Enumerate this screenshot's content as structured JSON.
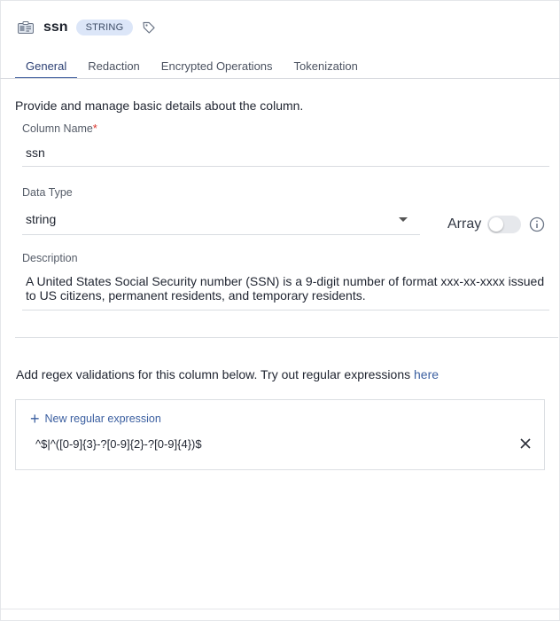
{
  "header": {
    "title": "ssn",
    "type_badge": "STRING",
    "icon": "column-icon"
  },
  "tabs": [
    {
      "label": "General",
      "active": true
    },
    {
      "label": "Redaction",
      "active": false
    },
    {
      "label": "Encrypted Operations",
      "active": false
    },
    {
      "label": "Tokenization",
      "active": false
    }
  ],
  "intro": "Provide and manage basic details about the column.",
  "column_name": {
    "label": "Column Name",
    "required_mark": "*",
    "value": "ssn"
  },
  "data_type": {
    "label": "Data Type",
    "value": "string"
  },
  "array_toggle": {
    "label": "Array",
    "enabled": false
  },
  "description": {
    "label": "Description",
    "value": "A United States Social Security number (SSN) is a 9-digit number of format xxx-xx-xxxx issued to US citizens, permanent residents, and temporary residents."
  },
  "regex": {
    "intro": "Add regex validations for this column below. Try out regular expressions",
    "link_text": "here",
    "add_label": "New regular expression",
    "expression": "^$|^([0-9]{3}-?[0-9]{2}-?[0-9]{4})$"
  },
  "colors": {
    "accent": "#3b5fa0",
    "badge_bg": "#dce6f8",
    "required": "#d9332b"
  }
}
